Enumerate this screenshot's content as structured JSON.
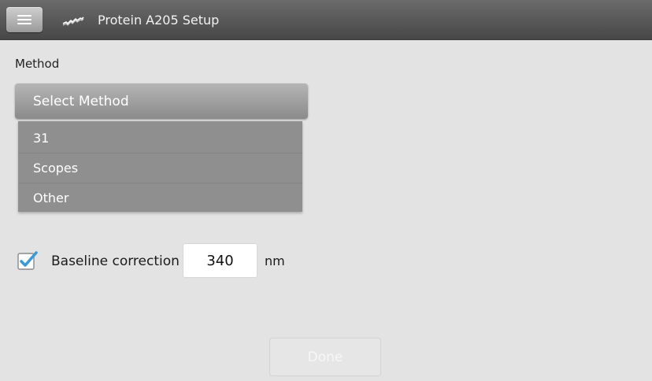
{
  "header": {
    "menu_icon": "hamburger-menu-icon",
    "app_icon": "spectrum-wave-icon",
    "title": "Protein A205 Setup"
  },
  "method": {
    "label": "Method",
    "select_label": "Select Method",
    "options": [
      "31",
      "Scopes",
      "Other"
    ]
  },
  "baseline": {
    "checked": true,
    "label": "Baseline correction",
    "value": "340",
    "unit": "nm",
    "checkbox_color": "#3a9ad9"
  },
  "footer": {
    "done_label": "Done",
    "done_enabled": false
  }
}
